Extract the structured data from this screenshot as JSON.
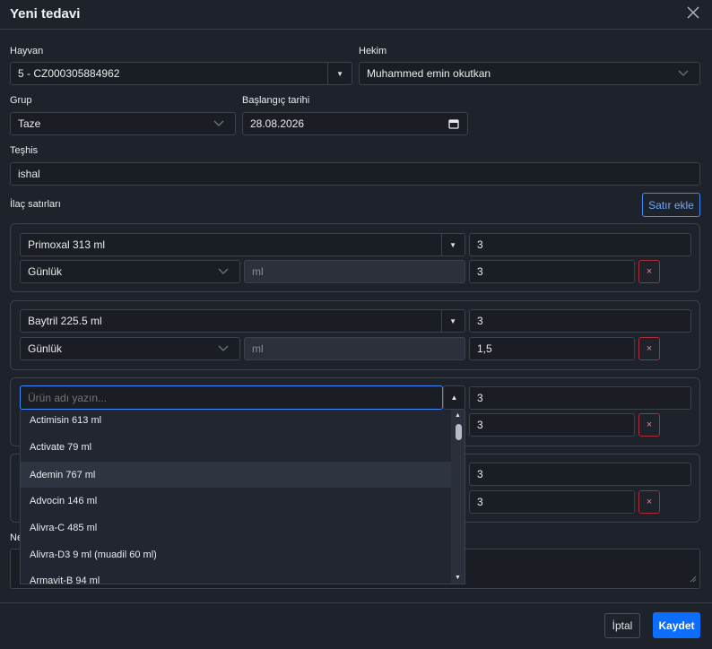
{
  "modal": {
    "title": "Yeni tedavi",
    "close_icon": "close-icon"
  },
  "form": {
    "animal": {
      "label": "Hayvan",
      "value": "5 - CZ000305884962"
    },
    "vet": {
      "label": "Hekim",
      "value": "Muhammed emin okutkan"
    },
    "group": {
      "label": "Grup",
      "value": "Taze"
    },
    "start_date": {
      "label": "Başlangıç tarihi",
      "value": "28.08.2026"
    },
    "diagnosis": {
      "label": "Teşhis",
      "value": "ishal"
    },
    "drug_lines_label": "İlaç satırları",
    "add_line_label": "Satır ekle",
    "notes_label": "Ne"
  },
  "lines": [
    {
      "product": "Primoxal 313 ml",
      "qty": "3",
      "freq": "Günlük",
      "unit": "ml",
      "dose": "3"
    },
    {
      "product": "Baytril 225.5 ml",
      "qty": "3",
      "freq": "Günlük",
      "unit": "ml",
      "dose": "1,5"
    },
    {
      "product_placeholder": "Ürün adı yazın...",
      "qty": "3",
      "dose": "3"
    },
    {
      "qty": "3",
      "dose": "3"
    }
  ],
  "dropdown": {
    "items": [
      "Actimisin 613 ml",
      "Activate 79 ml",
      "Ademin 767 ml",
      "Advocin 146 ml",
      "Alivra-C 485 ml",
      "Alivra-D3 9 ml (muadil 60 ml)",
      "Armavit-B 94 ml"
    ]
  },
  "footer": {
    "cancel_label": "İptal",
    "save_label": "Kaydet"
  },
  "delete_glyph": "×",
  "colors": {
    "primary": "#0d6efd",
    "danger": "#b02a37",
    "background": "#1e222b"
  }
}
